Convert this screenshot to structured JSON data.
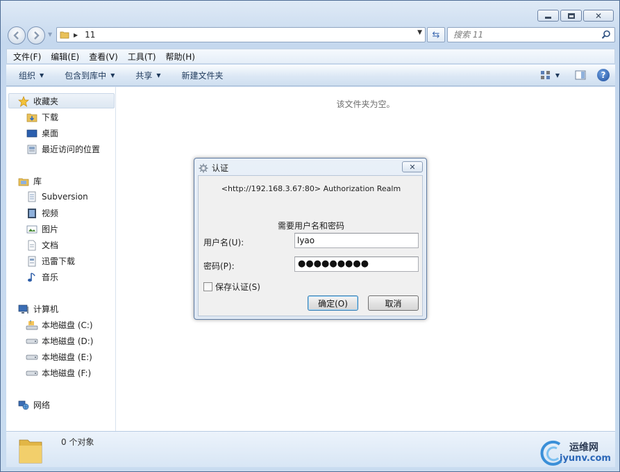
{
  "window": {
    "address_crumb": "11",
    "search_placeholder": "搜索 11"
  },
  "menubar": {
    "items": [
      "文件(F)",
      "编辑(E)",
      "查看(V)",
      "工具(T)",
      "帮助(H)"
    ]
  },
  "toolbar": {
    "organize": "组织",
    "include_library": "包含到库中",
    "share": "共享",
    "new_folder": "新建文件夹"
  },
  "sidebar": {
    "favorites": "收藏夹",
    "downloads": "下载",
    "desktop": "桌面",
    "recent": "最近访问的位置",
    "libraries": "库",
    "subversion": "Subversion",
    "videos": "视频",
    "pictures": "图片",
    "documents": "文档",
    "thunder": "迅雷下载",
    "music": "音乐",
    "computer": "计算机",
    "disk_c": "本地磁盘 (C:)",
    "disk_d": "本地磁盘 (D:)",
    "disk_e": "本地磁盘 (E:)",
    "disk_f": "本地磁盘 (F:)",
    "network": "网络"
  },
  "main": {
    "empty_message": "该文件夹为空。"
  },
  "statusbar": {
    "count_text": "0 个对象",
    "watermark_cn": "运维网",
    "watermark_en": "iyunv.com"
  },
  "dialog": {
    "title": "认证",
    "realm": "<http://192.168.3.67:80> Authorization Realm",
    "prompt": "需要用户名和密码",
    "username_label": "用户名(U):",
    "username_value": "lyao",
    "password_label": "密码(P):",
    "password_mask": "●●●●●●●●●",
    "save_label": "保存认证(S)",
    "ok_label": "确定(O)",
    "cancel_label": "取消"
  }
}
